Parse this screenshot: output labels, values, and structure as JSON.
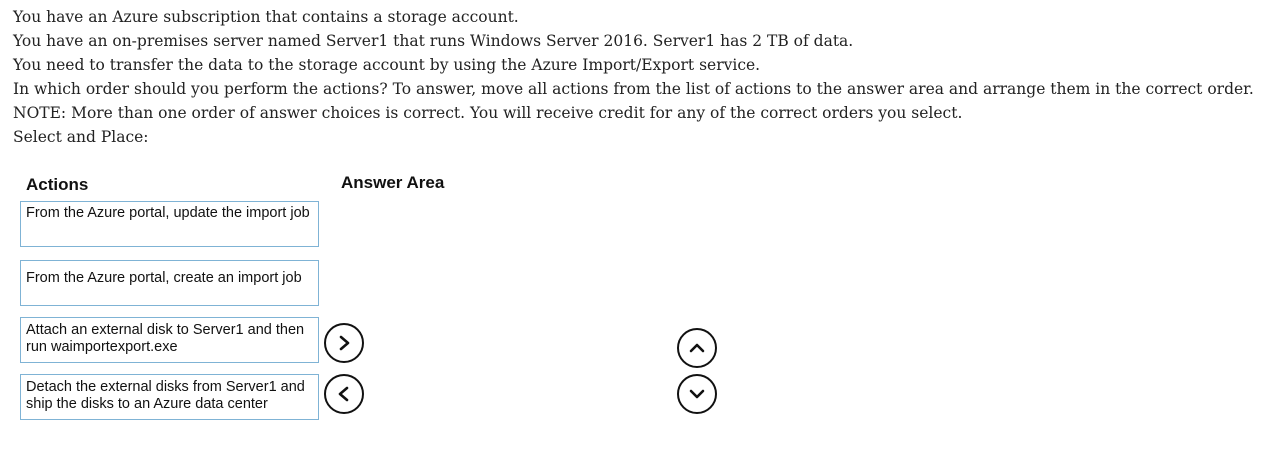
{
  "question": {
    "lines": [
      "You have an Azure subscription that contains a storage account.",
      "You have an on-premises server named Server1 that runs Windows Server 2016. Server1 has 2 TB of data.",
      "You need to transfer the data to the storage account by using the Azure Import/Export service.",
      "In which order should you perform the actions? To answer, move all actions from the list of actions to the answer area and arrange them in the correct order.",
      "NOTE: More than one order of answer choices is correct. You will receive credit for any of the correct orders you select.",
      "Select and Place:"
    ]
  },
  "actions_header": "Actions",
  "answer_area_header": "Answer Area",
  "actions": [
    "From the Azure portal, update the import job",
    "From the Azure portal, create an import job",
    "Attach an external disk to Server1 and then run waimportexport.exe",
    "Detach the external disks from Server1 and ship the disks to an Azure data center"
  ],
  "icons": {
    "move_right": "chevron-right-icon",
    "move_left": "chevron-left-icon",
    "move_up": "chevron-up-icon",
    "move_down": "chevron-down-icon"
  }
}
